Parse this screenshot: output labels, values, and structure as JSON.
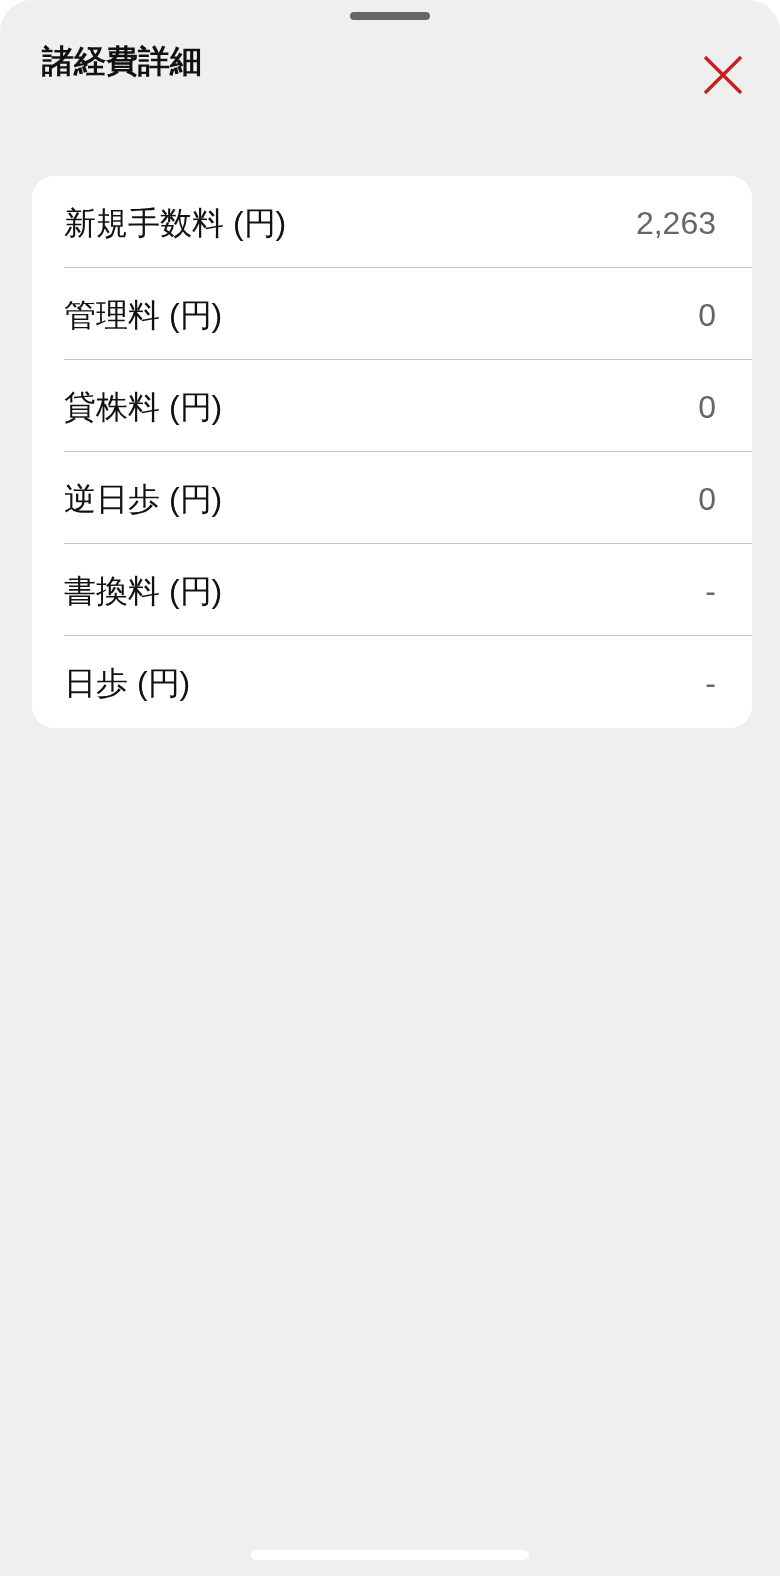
{
  "sheet": {
    "title": "諸経費詳細"
  },
  "fees": [
    {
      "label": "新規手数料 (円)",
      "value": "2,263"
    },
    {
      "label": "管理料 (円)",
      "value": "0"
    },
    {
      "label": "貸株料 (円)",
      "value": "0"
    },
    {
      "label": "逆日歩 (円)",
      "value": "0"
    },
    {
      "label": "書換料 (円)",
      "value": "-"
    },
    {
      "label": "日歩 (円)",
      "value": "-"
    }
  ]
}
